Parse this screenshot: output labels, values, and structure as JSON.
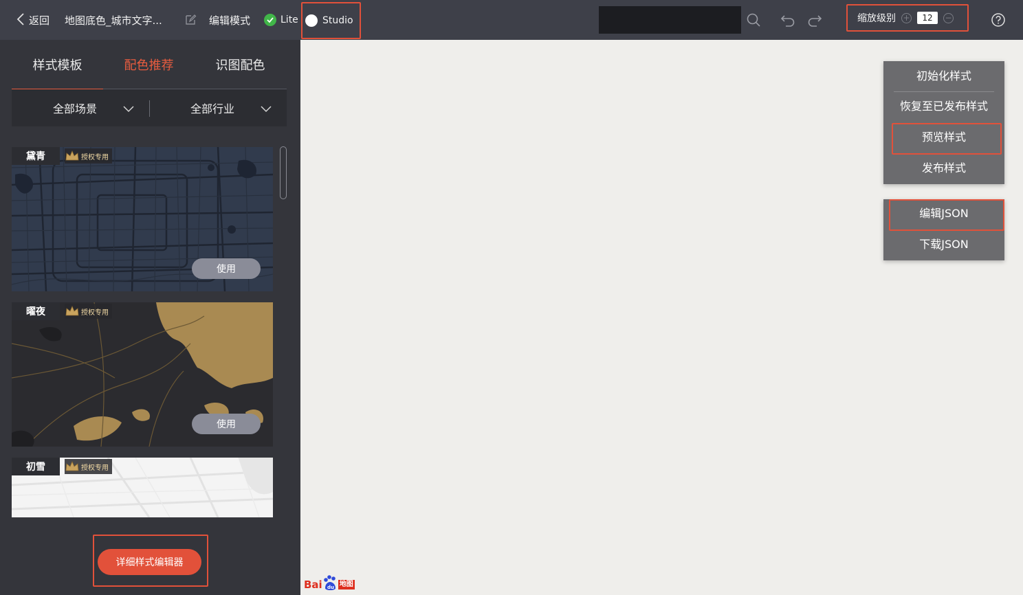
{
  "topbar": {
    "back_label": "返回",
    "doc_title": "地图底色_城市文字...",
    "edit_mode_label": "编辑模式",
    "lite_label": "Lite",
    "studio_label": "Studio",
    "search_placeholder": "",
    "zoom_label": "缩放级别",
    "zoom_value": "12",
    "icons": [
      "chevron-left-icon",
      "edit-icon",
      "check-circle-icon",
      "search-icon",
      "undo-icon",
      "redo-icon",
      "zoom-in-icon",
      "zoom-out-icon",
      "help-icon"
    ],
    "colors": {
      "bar_bg": "#3e4049",
      "highlight": "#e2513a",
      "check": "#41b649"
    }
  },
  "sidebar": {
    "tabs": [
      {
        "label": "样式模板",
        "active": false,
        "underlined": true
      },
      {
        "label": "配色推荐",
        "active": true,
        "underlined": false
      },
      {
        "label": "识图配色",
        "active": false,
        "underlined": false
      }
    ],
    "filters": [
      {
        "label": "全部场景"
      },
      {
        "label": "全部行业"
      }
    ],
    "cards": [
      {
        "name": "黛青",
        "badge": "授权专用",
        "use_label": "使用"
      },
      {
        "name": "曜夜",
        "badge": "授权专用",
        "use_label": "使用"
      },
      {
        "name": "初雪",
        "badge": "授权专用"
      }
    ],
    "detail_editor_label": "详细样式编辑器",
    "colors": {
      "bg": "#34353b",
      "accent": "#e85c3f",
      "button": "#e2513a"
    }
  },
  "right_panel": {
    "group1": [
      "初始化样式",
      "恢复至已发布样式",
      "预览样式",
      "发布样式"
    ],
    "group2": [
      "编辑JSON",
      "下载JSON"
    ]
  },
  "brand": {
    "logo_text": "Bai",
    "logo_suffix": "地图"
  }
}
